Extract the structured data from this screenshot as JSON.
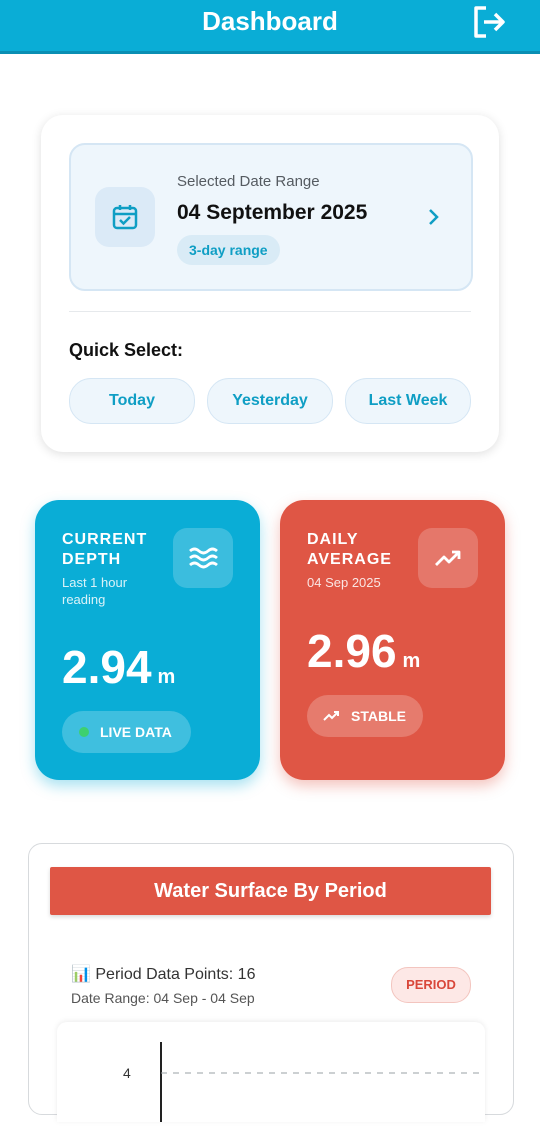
{
  "header": {
    "title": "Dashboard",
    "logout_icon": "logout-icon"
  },
  "date_card": {
    "label": "Selected Date Range",
    "date": "04 September 2025",
    "range": "3-day range",
    "icon": "calendar-check-icon",
    "quick_select_title": "Quick Select:",
    "quick_buttons": [
      "Today",
      "Yesterday",
      "Last Week"
    ]
  },
  "current_depth": {
    "title": "CURRENT DEPTH",
    "subtitle": "Last 1 hour reading",
    "value": "2.94",
    "unit": "m",
    "status": "LIVE DATA",
    "icon": "waves-icon",
    "color": "#0aadd6"
  },
  "daily_average": {
    "title": "DAILY AVERAGE",
    "subtitle": "04 Sep 2025",
    "value": "2.96",
    "unit": "m",
    "status": "STABLE",
    "icon": "trend-up-icon",
    "color": "#df5645"
  },
  "chart_section": {
    "title": "Water Surface By Period",
    "data_points": "📊 Period Data Points: 16",
    "date_range": "Date Range: 04 Sep - 04 Sep",
    "badge": "PERIOD"
  },
  "chart_data": {
    "type": "line",
    "y_ticks": [
      "4"
    ]
  }
}
